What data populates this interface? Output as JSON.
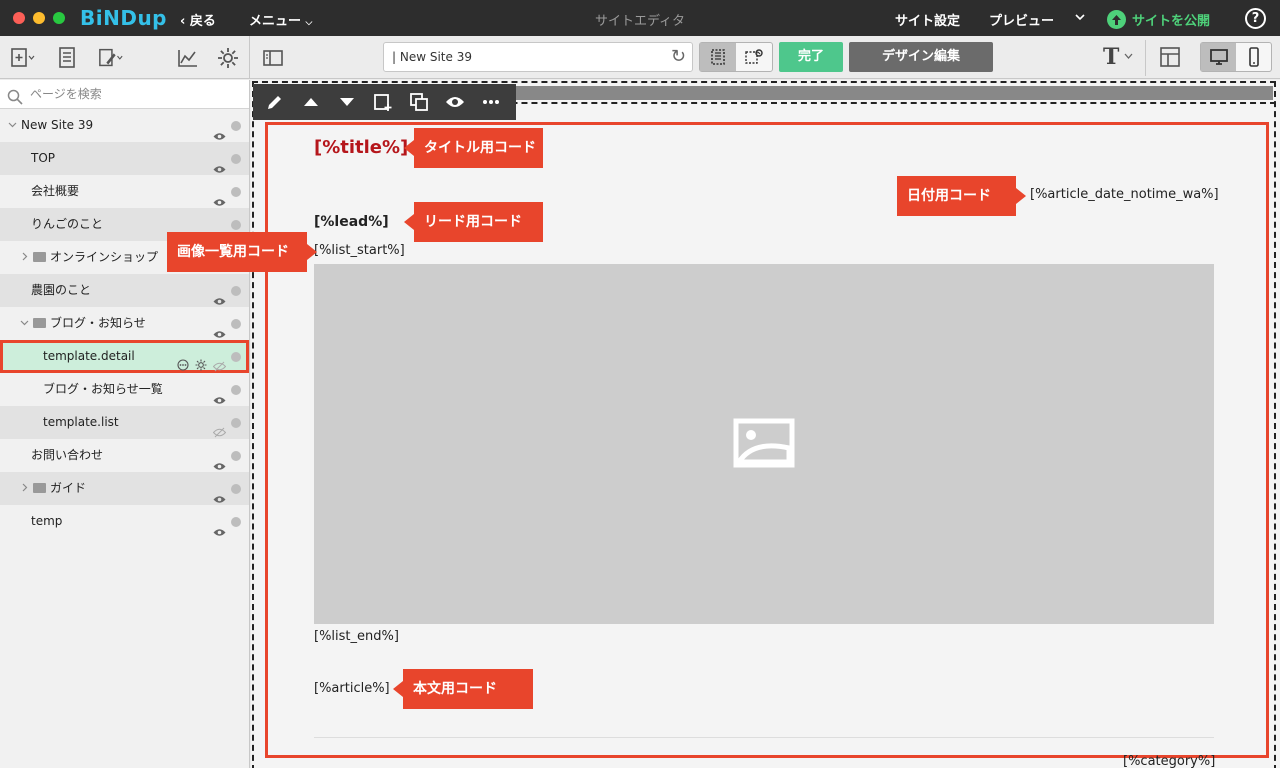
{
  "titlebar": {
    "logo": "BiNDup",
    "back": "戻る",
    "menu": "メニュー",
    "center_title": "サイトエディタ",
    "site_settings": "サイト設定",
    "preview": "プレビュー",
    "publish": "サイトを公開",
    "help": "?"
  },
  "toolbar": {
    "url_value": "| New Site 39",
    "done_label": "完了",
    "design_label": "デザイン編集",
    "font_icon_label": "T"
  },
  "sidebar": {
    "search_placeholder": "ページを検索",
    "items": [
      {
        "label": "New Site 39"
      },
      {
        "label": "TOP"
      },
      {
        "label": "会社概要"
      },
      {
        "label": "りんごのこと"
      },
      {
        "label": "オンラインショップ"
      },
      {
        "label": "農園のこと"
      },
      {
        "label": "ブログ・お知らせ"
      },
      {
        "label": "template.detail"
      },
      {
        "label": "ブログ・お知らせ一覧"
      },
      {
        "label": "template.list"
      },
      {
        "label": "お問い合わせ"
      },
      {
        "label": "ガイド"
      },
      {
        "label": "temp"
      }
    ]
  },
  "canvas": {
    "title_code": "[%title%]",
    "lead_code": "[%lead%]",
    "date_code": "[%article_date_notime_wa%]",
    "list_start_code": "[%list_start%]",
    "list_end_code": "[%list_end%]",
    "article_code": "[%article%]",
    "category_code": "[%category%]"
  },
  "callouts": {
    "title": "タイトル用コード",
    "lead": "リード用コード",
    "date": "日付用コード",
    "image_list": "画像一覧用コード",
    "article": "本文用コード"
  },
  "colors": {
    "accent_red": "#e8452c",
    "publish_green": "#4ed17a",
    "done_green": "#4ec78c",
    "title_code_red": "#b5161b",
    "logo_blue": "#34c0e8"
  }
}
